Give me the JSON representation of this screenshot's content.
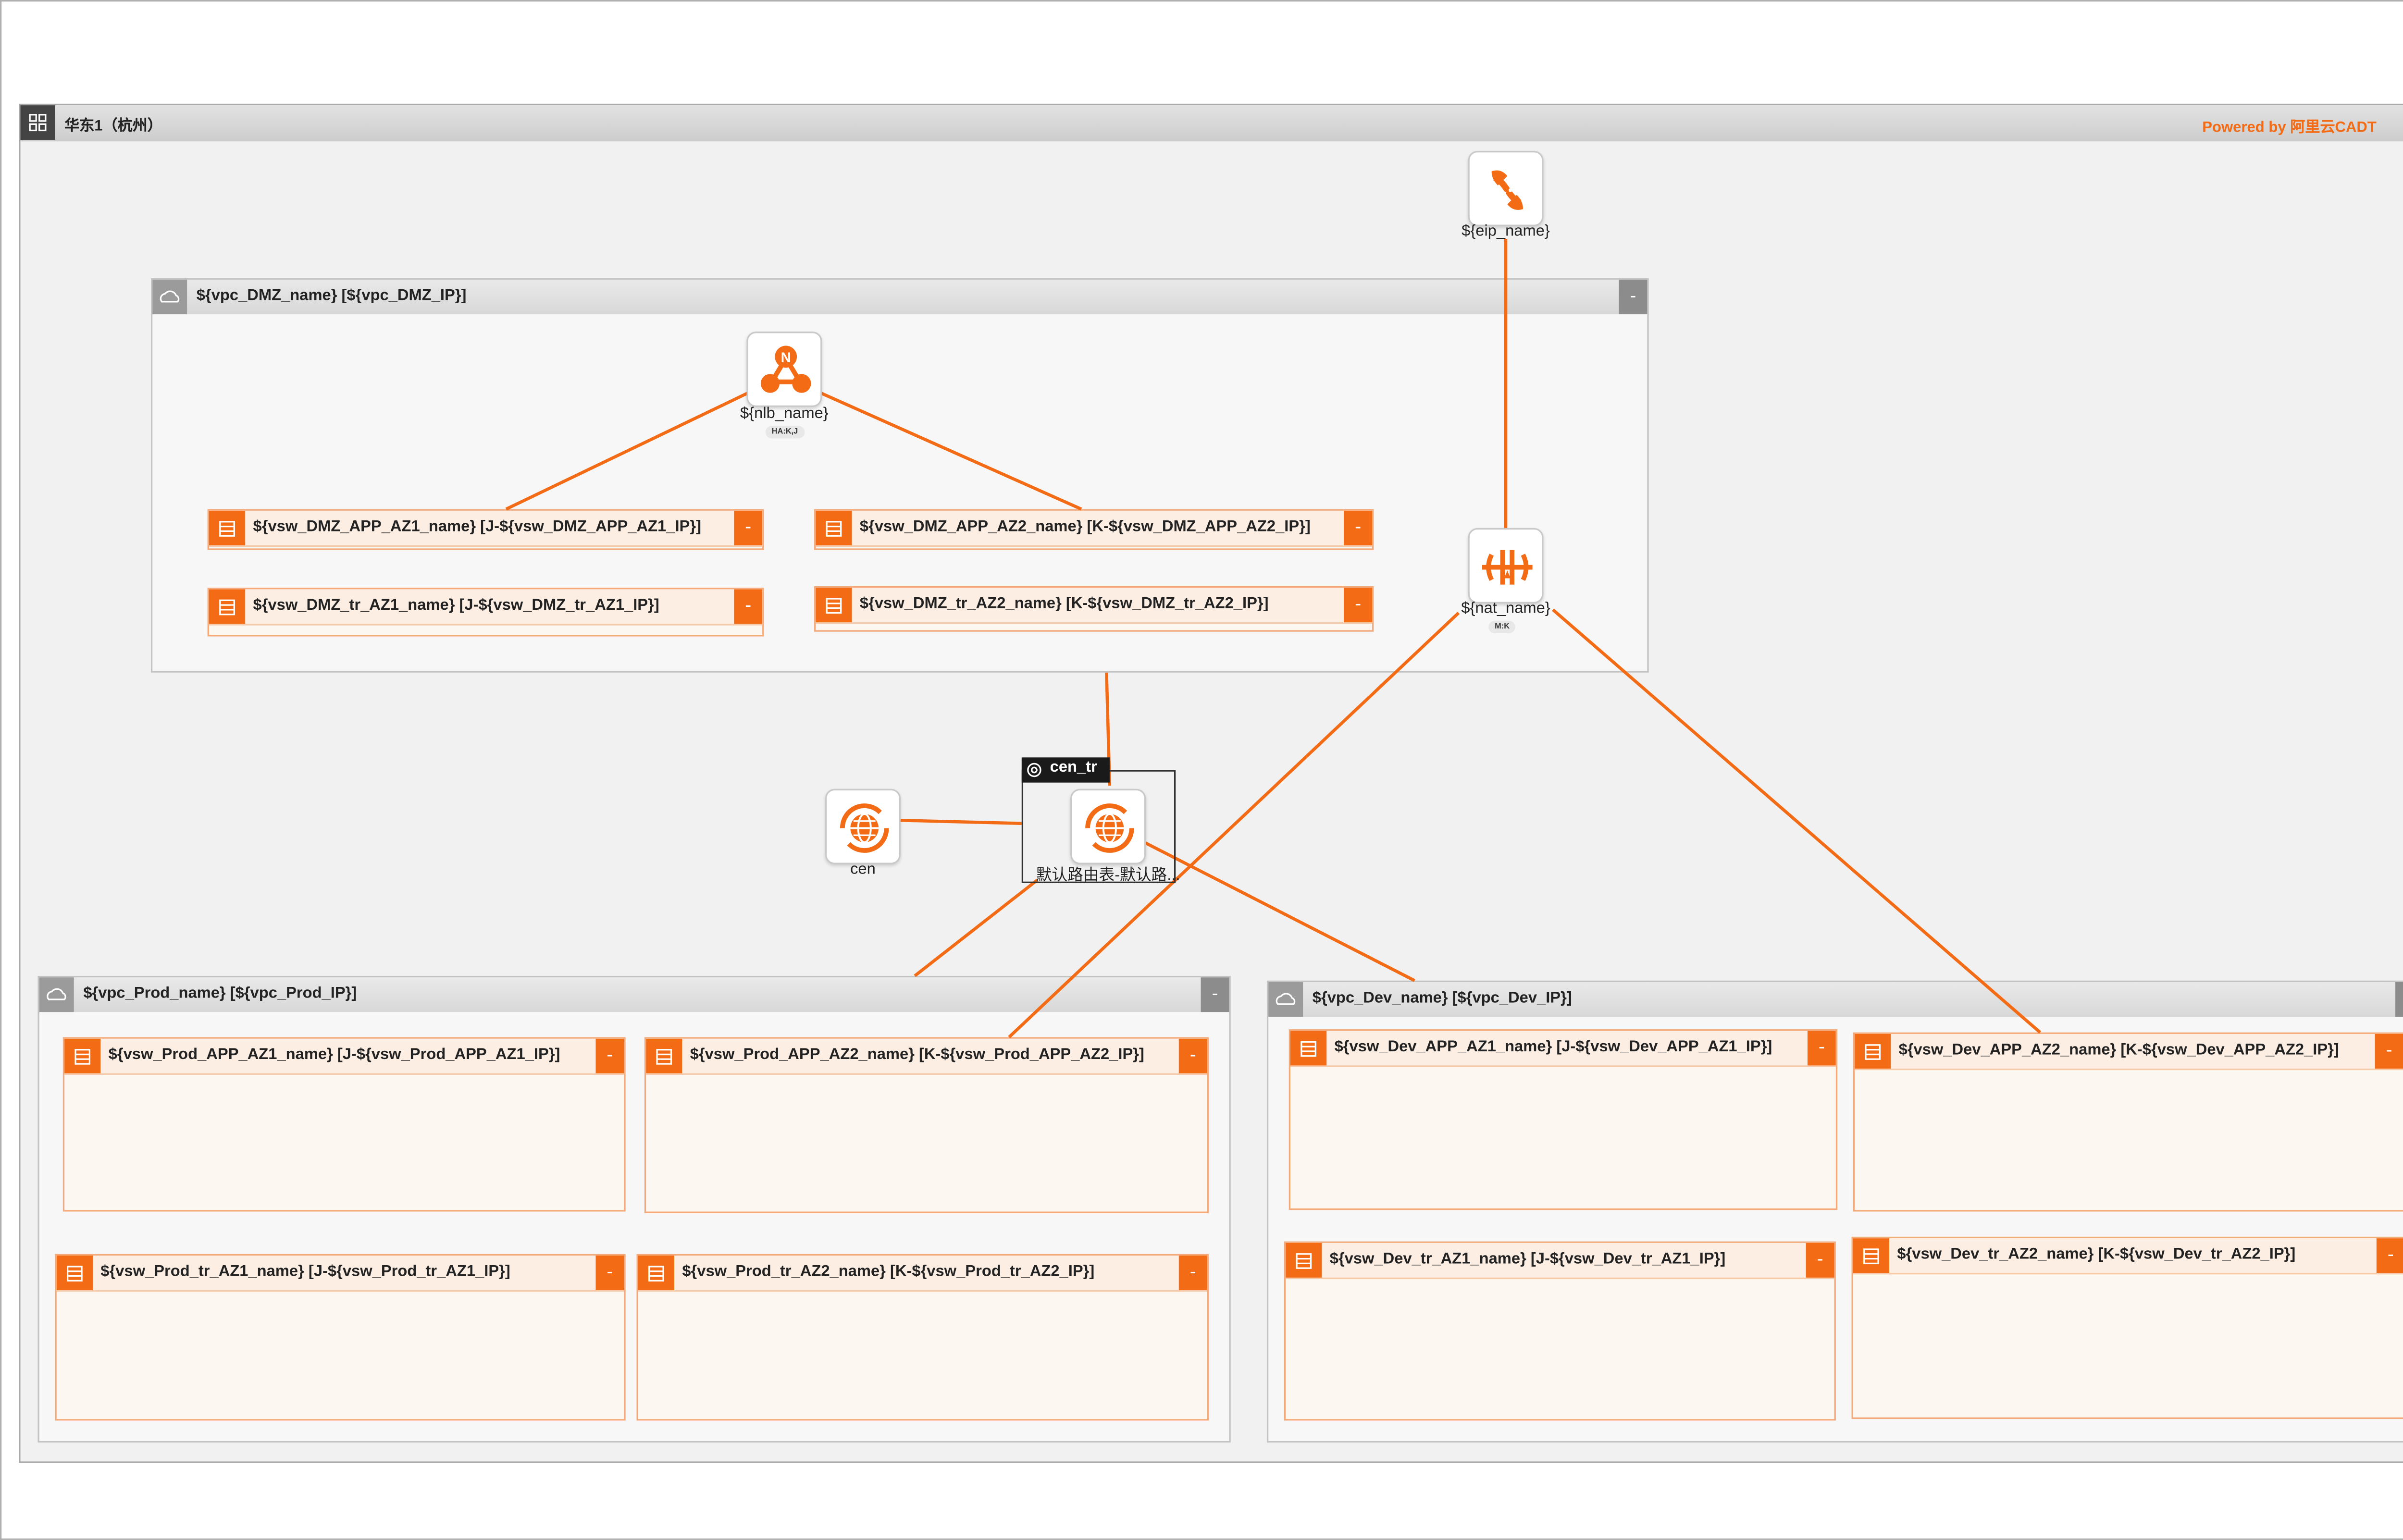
{
  "region": {
    "title": "华东1（杭州）",
    "powered": "Powered by 阿里云CADT",
    "collapse": "-"
  },
  "nodes": {
    "eip": "${eip_name}",
    "nlb": "${nlb_name}",
    "nlb_badge": "HA:K,J",
    "nat": "${nat_name}",
    "nat_badge": "M:K",
    "cen": "cen",
    "cen_tr_title": "cen_tr",
    "cen_tr_route": "默认路由表-默认路..."
  },
  "vpcs": {
    "dmz": "${vpc_DMZ_name} [${vpc_DMZ_IP}]",
    "prod": "${vpc_Prod_name} [${vpc_Prod_IP}]",
    "dev": "${vpc_Dev_name} [${vpc_Dev_IP}]"
  },
  "vswitches": {
    "dmz_app_az1": "${vsw_DMZ_APP_AZ1_name} [J-${vsw_DMZ_APP_AZ1_IP}]",
    "dmz_app_az2": "${vsw_DMZ_APP_AZ2_name} [K-${vsw_DMZ_APP_AZ2_IP}]",
    "dmz_tr_az1": "${vsw_DMZ_tr_AZ1_name} [J-${vsw_DMZ_tr_AZ1_IP}]",
    "dmz_tr_az2": "${vsw_DMZ_tr_AZ2_name} [K-${vsw_DMZ_tr_AZ2_IP}]",
    "prod_app_az1": "${vsw_Prod_APP_AZ1_name} [J-${vsw_Prod_APP_AZ1_IP}]",
    "prod_app_az2": "${vsw_Prod_APP_AZ2_name} [K-${vsw_Prod_APP_AZ2_IP}]",
    "prod_tr_az1": "${vsw_Prod_tr_AZ1_name} [J-${vsw_Prod_tr_AZ1_IP}]",
    "prod_tr_az2": "${vsw_Prod_tr_AZ2_name} [K-${vsw_Prod_tr_AZ2_IP}]",
    "dev_app_az1": "${vsw_Dev_APP_AZ1_name} [J-${vsw_Dev_APP_AZ1_IP}]",
    "dev_app_az2": "${vsw_Dev_APP_AZ2_name} [K-${vsw_Dev_APP_AZ2_IP}]",
    "dev_tr_az1": "${vsw_Dev_tr_AZ1_name} [J-${vsw_Dev_tr_AZ1_IP}]",
    "dev_tr_az2": "${vsw_Dev_tr_AZ2_name} [K-${vsw_Dev_tr_AZ2_IP}]"
  },
  "collapse_symbol": "-",
  "colors": {
    "accent": "#f46b16",
    "region_header": "#d4d4d4",
    "vpc_header": "#dcdcdc",
    "vswitch_fill": "#fdf7f2"
  },
  "icons": {
    "region": "region-grid-icon",
    "vpc": "vpc-cloud-icon",
    "vswitch": "vswitch-list-icon",
    "eip": "eip-link-icon",
    "nlb": "nlb-icon",
    "nat": "nat-gateway-icon",
    "cen": "cen-globe-icon"
  }
}
